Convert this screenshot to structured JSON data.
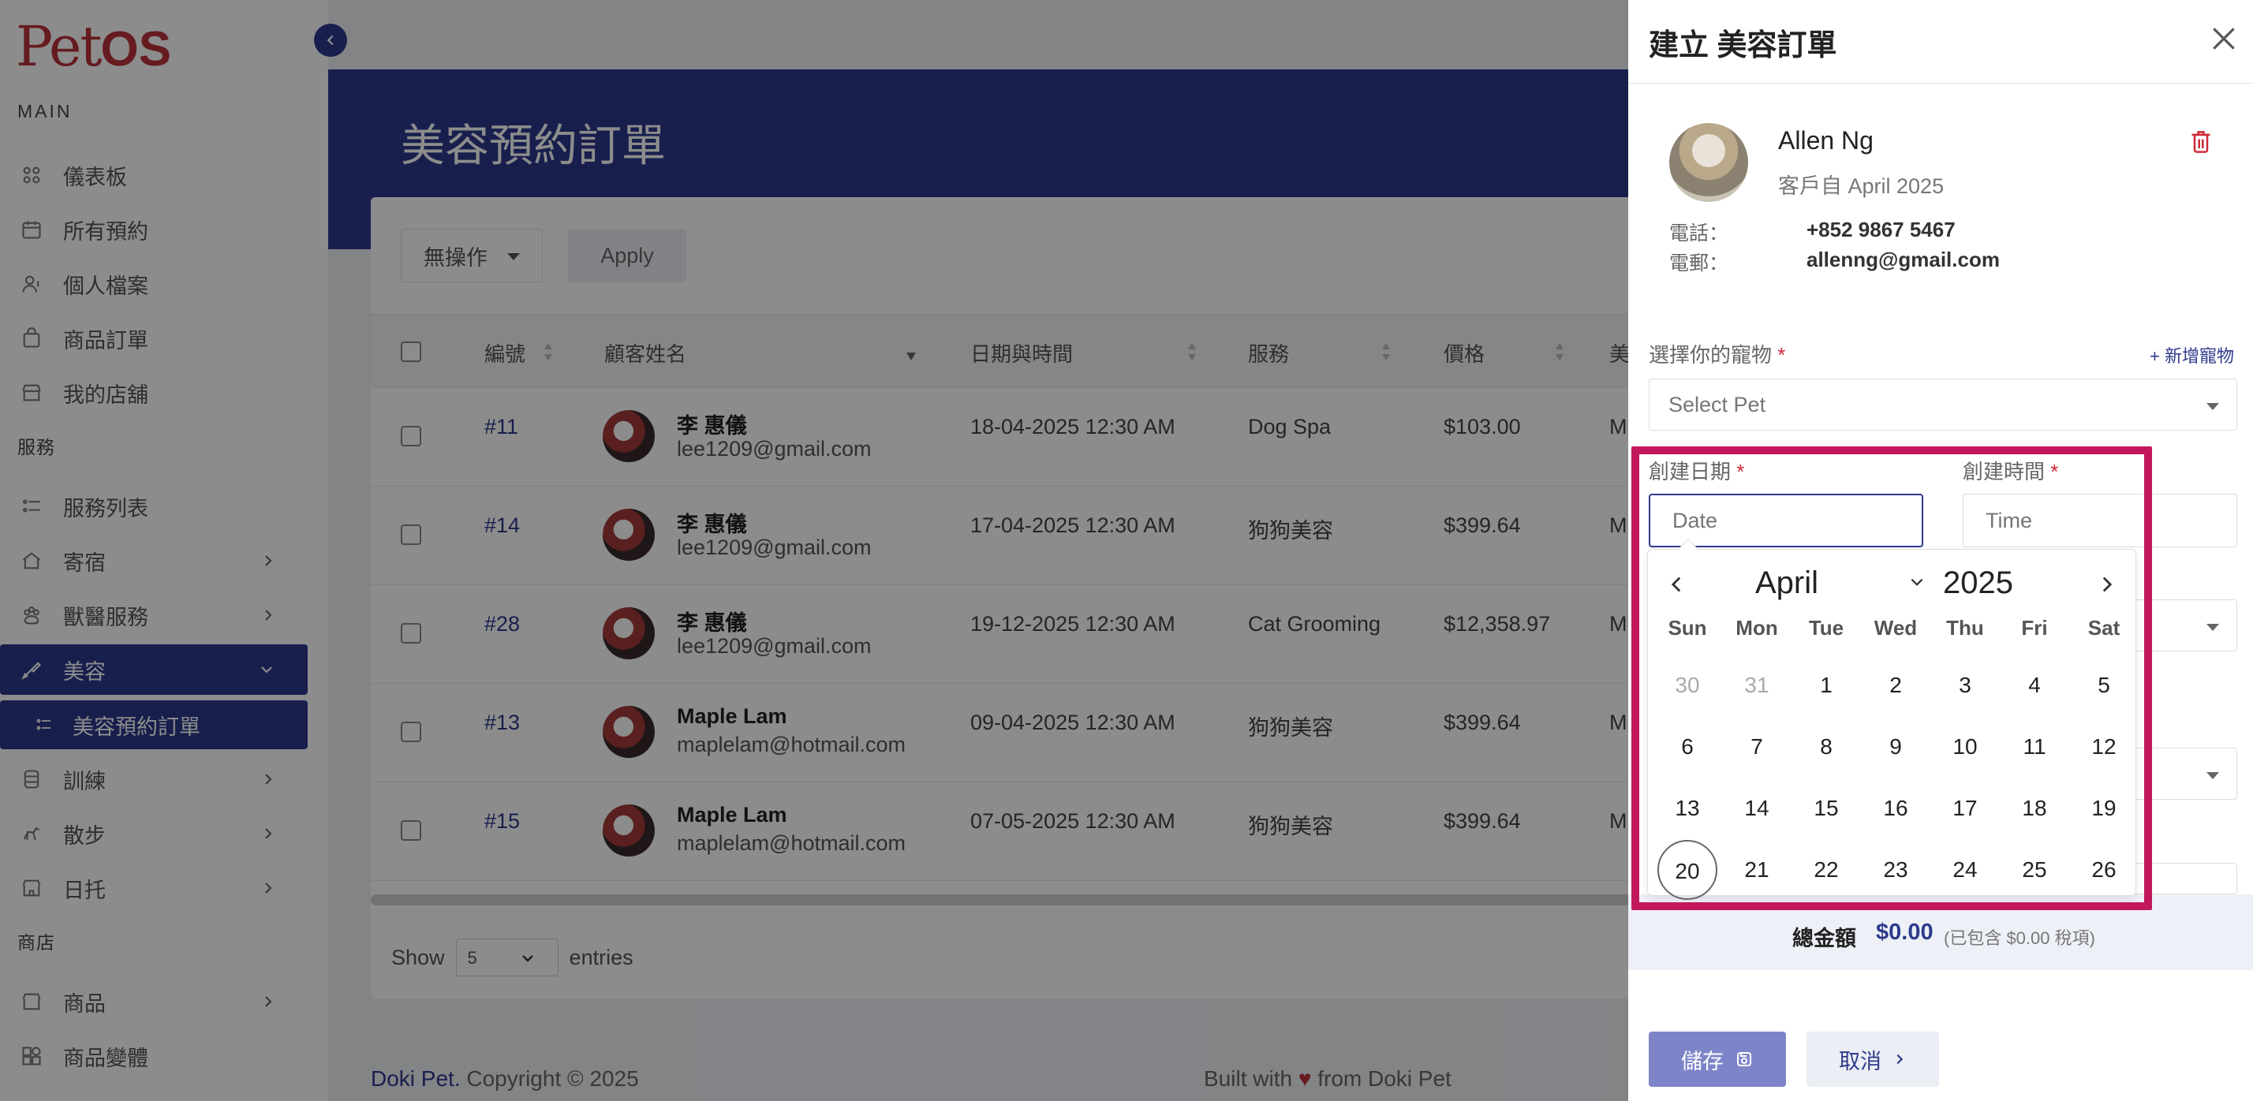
{
  "app": {
    "logo_main": "Pet",
    "logo_os": "OS"
  },
  "sidebar": {
    "sections": {
      "main": "MAIN",
      "services": "服務",
      "shop": "商店"
    },
    "main_items": [
      {
        "label": "儀表板",
        "icon": "dashboard-icon"
      },
      {
        "label": "所有預約",
        "icon": "calendar-icon"
      },
      {
        "label": "個人檔案",
        "icon": "user-icon"
      },
      {
        "label": "商品訂單",
        "icon": "bag-icon"
      },
      {
        "label": "我的店舖",
        "icon": "store-icon"
      }
    ],
    "service_items": [
      {
        "label": "服務列表",
        "icon": "list-icon"
      },
      {
        "label": "寄宿",
        "icon": "house-icon"
      },
      {
        "label": "獸醫服務",
        "icon": "vet-icon"
      },
      {
        "label": "美容",
        "icon": "scissors-icon"
      },
      {
        "label": "美容預約訂單",
        "icon": "sublist-icon"
      },
      {
        "label": "訓練",
        "icon": "training-icon"
      },
      {
        "label": "散步",
        "icon": "walk-icon"
      },
      {
        "label": "日托",
        "icon": "daycare-icon"
      }
    ],
    "shop_items": [
      {
        "label": "商品",
        "icon": "product-icon"
      },
      {
        "label": "商品變體",
        "icon": "variant-icon"
      }
    ]
  },
  "page": {
    "title": "美容預約訂單"
  },
  "toolbar": {
    "bulk_action": "無操作",
    "apply": "Apply"
  },
  "table": {
    "headers": [
      "編號",
      "顧客姓名",
      "日期與時間",
      "服務",
      "價格",
      "美"
    ],
    "rows": [
      {
        "id": "#11",
        "name": "李 惠儀",
        "email": "lee1209@gmail.com",
        "datetime": "18-04-2025 12:30 AM",
        "service": "Dog Spa",
        "price": "$103.00",
        "more": "M"
      },
      {
        "id": "#14",
        "name": "李 惠儀",
        "email": "lee1209@gmail.com",
        "datetime": "17-04-2025 12:30 AM",
        "service": "狗狗美容",
        "price": "$399.64",
        "more": "M"
      },
      {
        "id": "#28",
        "name": "李 惠儀",
        "email": "lee1209@gmail.com",
        "datetime": "19-12-2025 12:30 AM",
        "service": "Cat Grooming",
        "price": "$12,358.97",
        "more": "M"
      },
      {
        "id": "#13",
        "name": "Maple Lam",
        "email": "maplelam@hotmail.com",
        "datetime": "09-04-2025 12:30 AM",
        "service": "狗狗美容",
        "price": "$399.64",
        "more": "M"
      },
      {
        "id": "#15",
        "name": "Maple Lam",
        "email": "maplelam@hotmail.com",
        "datetime": "07-05-2025 12:30 AM",
        "service": "狗狗美容",
        "price": "$399.64",
        "more": "M"
      }
    ],
    "show_label": "Show",
    "page_size": "5",
    "entries_label": "entries"
  },
  "footer": {
    "brand": "Doki Pet.",
    "copyright": " Copyright © 2025",
    "built_with": "Built with",
    "heart": "♥",
    "from": "from Doki Pet"
  },
  "drawer": {
    "title": "建立 美容訂單",
    "customer": {
      "name": "Allen Ng",
      "since": "客戶自 April 2025",
      "phone_label": "電話：",
      "phone": "+852 9867 5467",
      "email_label": "電郵：",
      "email": "allenng@gmail.com"
    },
    "pet": {
      "label": "選擇你的寵物",
      "required": "*",
      "add_label": "+ 新增寵物",
      "placeholder": "Select Pet"
    },
    "date": {
      "label": "創建日期",
      "required": "*",
      "placeholder": "Date"
    },
    "time": {
      "label": "創建時間",
      "required": "*",
      "placeholder": "Time"
    },
    "total": {
      "label": "總金額",
      "value": "$0.00",
      "tax_note": "(已包含 $0.00 稅項)"
    },
    "save_label": "儲存",
    "cancel_label": "取消"
  },
  "calendar": {
    "month": "April",
    "year": "2025",
    "weekdays": [
      "Sun",
      "Mon",
      "Tue",
      "Wed",
      "Thu",
      "Fri",
      "Sat"
    ],
    "weeks": [
      [
        "30",
        "31",
        "1",
        "2",
        "3",
        "4",
        "5"
      ],
      [
        "6",
        "7",
        "8",
        "9",
        "10",
        "11",
        "12"
      ],
      [
        "13",
        "14",
        "15",
        "16",
        "17",
        "18",
        "19"
      ],
      [
        "20",
        "21",
        "22",
        "23",
        "24",
        "25",
        "26"
      ]
    ],
    "muted_days": [
      "30",
      "31"
    ],
    "today": "20"
  },
  "colors": {
    "primary": "#2d3a8c",
    "highlight": "#c2185b",
    "danger": "#d0283a",
    "brand": "#b8323a"
  }
}
